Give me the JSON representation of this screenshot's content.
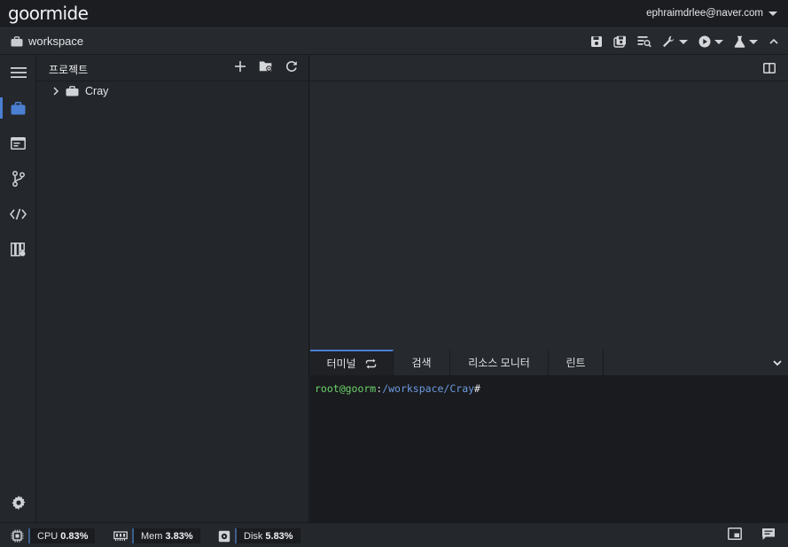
{
  "brand": {
    "name": "goormide"
  },
  "user": {
    "email": "ephraimdrlee@naver.com"
  },
  "toolbar": {
    "workspace_label": "workspace"
  },
  "project": {
    "title": "프로젝트",
    "tree": [
      {
        "label": "Cray"
      }
    ]
  },
  "terminal": {
    "tabs": [
      {
        "label": "터미널"
      },
      {
        "label": "검색"
      },
      {
        "label": "리소스 모니터"
      },
      {
        "label": "린트"
      }
    ],
    "prompt_user": "root@goorm",
    "prompt_sep": ":",
    "prompt_path": "/workspace/Cray",
    "prompt_hash": "#"
  },
  "status": {
    "cpu_label": "CPU",
    "cpu_value": "0.83%",
    "mem_label": "Mem",
    "mem_value": "3.83%",
    "disk_label": "Disk",
    "disk_value": "5.83%"
  },
  "colors": {
    "accent": "#4a7fd1",
    "prompt_user": "#6bd36b",
    "prompt_path": "#6c9be0"
  }
}
